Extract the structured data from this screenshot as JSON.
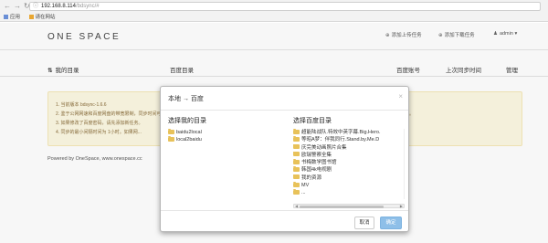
{
  "browser": {
    "address_host": "192.168.8.114",
    "address_path": "/bdsync/#",
    "bookmarks": [
      "应用",
      "请在网站"
    ]
  },
  "app": {
    "brand": "ONE SPACE",
    "nav": {
      "upload_task": "添加上传任务",
      "download_task": "添加下载任务",
      "user": "admin"
    }
  },
  "table": {
    "headers": {
      "my_dir": "我的目录",
      "baidu_dir": "百度目录",
      "baidu_account": "百度账号",
      "last_sync": "上次同步时间",
      "manage": "管理"
    }
  },
  "info": {
    "lines": [
      "1. 当前版本 bdsync-1.6.6",
      "2. 鉴于公网网速和百度网盘的带宽限制，同步时间可能较长，请在路由器设置中开启端口的关系。",
      "3. 如果修改了百度密码，请先添加新任务。",
      "4. 同步的最小间隔时间为 1小时。如果网..."
    ],
    "tail": "IEC。"
  },
  "footer": "Powered by OneSpace, www.onespace.cc",
  "modal": {
    "title": "本地 → 百度",
    "close": "×",
    "left_title": "选择我的目录",
    "left_items": [
      "baidu2local",
      "local2baidu"
    ],
    "right_title": "选择百度目录",
    "right_items": [
      "超能陆战队.特效中英字幕.Big.Hero.",
      "等昭A梦：伴我同行.Stand.by.Me.D",
      "庆完美动画照片合集",
      "欧瑞警察全集",
      "书梅数学图书馆",
      "韩国4k电视剧",
      "我的资源",
      "MV",
      "..."
    ],
    "cancel_label": "取消",
    "ok_label": "确定"
  },
  "colors": {
    "info_bg": "#fcf8e3",
    "info_text": "#8a6d3b",
    "primary_btn": "#8ebfe8",
    "folder": "#e8c25a"
  }
}
